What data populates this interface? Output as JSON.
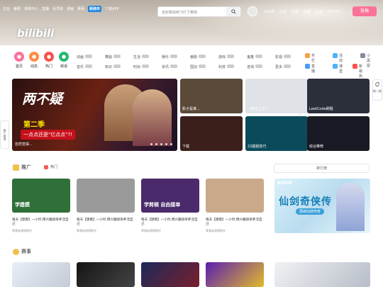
{
  "nav": {
    "left": [
      "主站",
      "番剧",
      "游戏中心",
      "直播",
      "会员购",
      "漫画",
      "赛事"
    ],
    "badge": "新跨年",
    "download": "下载APP"
  },
  "search": {
    "placeholder": "去好像找到飞行了哪场"
  },
  "user": {
    "links": [
      "大会员",
      "消息",
      "动态",
      "收藏",
      "历史",
      "创作中心"
    ],
    "upload": "投稿"
  },
  "logo": "bilibili",
  "channels": [
    {
      "label": "首页",
      "color": "#fb7299"
    },
    {
      "label": "动态",
      "color": "#ff8c43"
    },
    {
      "label": "热门",
      "color": "#f7534b"
    },
    {
      "label": "频道",
      "color": "#27b871"
    }
  ],
  "categories": [
    {
      "name": "动画",
      "num": "",
      "row": 0,
      "col": 0
    },
    {
      "name": "舞蹈",
      "num": "",
      "row": 0,
      "col": 1
    },
    {
      "name": "生活",
      "num": "",
      "row": 0,
      "col": 2
    },
    {
      "name": "娱乐",
      "num": "",
      "row": 0,
      "col": 3
    },
    {
      "name": "番剧",
      "num": "",
      "row": 0,
      "col": 4
    },
    {
      "name": "游戏",
      "num": "",
      "row": 0,
      "col": 5
    },
    {
      "name": "鬼畜",
      "num": "",
      "row": 0,
      "col": 6
    },
    {
      "name": "影视",
      "num": "",
      "row": 0,
      "col": 7
    },
    {
      "name": "音乐",
      "num": "",
      "row": 1,
      "col": 0
    },
    {
      "name": "知识",
      "num": "",
      "row": 1,
      "col": 1
    },
    {
      "name": "时尚",
      "num": "",
      "row": 1,
      "col": 2
    },
    {
      "name": "资讯",
      "num": "",
      "row": 1,
      "col": 3
    },
    {
      "name": "国创",
      "num": "",
      "row": 1,
      "col": 4
    },
    {
      "name": "科技",
      "num": "",
      "row": 1,
      "col": 5
    },
    {
      "name": "咨询",
      "num": "",
      "row": 1,
      "col": 6
    },
    {
      "name": "更多",
      "num": "",
      "row": 1,
      "col": 7
    }
  ],
  "quicklinks": [
    "专栏",
    "活动",
    "小黑屋",
    "直播",
    "课堂",
    "新歌热榜"
  ],
  "carousel": {
    "title": "第二季",
    "caption": "忽然觉得...",
    "slogan": "一点点还是\"亿点点\"?!"
  },
  "videos": [
    {
      "caption": "影子是谁...",
      "color": "#5b4a3a"
    },
    {
      "caption": "《拳王之王》",
      "color": "#dfe2e6"
    },
    {
      "caption": "LeetCode刷题",
      "color": "#2a2f3a"
    },
    {
      "caption": "下载",
      "color": "#3a1f1a"
    },
    {
      "caption": "22腿姐技巧",
      "color": "#0b4a5a"
    },
    {
      "caption": "综合推荐",
      "color": "#1a1a24"
    }
  ],
  "sections": {
    "promo": "推广",
    "hot": "热门",
    "rank": "排行榜",
    "esports": "赛事"
  },
  "cards": [
    {
      "label": "学建模",
      "title": "每天【建模】一小时,用兴趣接单养活自己",
      "author": "零基础建模教学",
      "color": "#2e6f3a"
    },
    {
      "label": "",
      "title": "每天【建模】一小时,用兴趣接单养活自己",
      "author": "零基础建模教学",
      "color": "#9a9a9a"
    },
    {
      "label": "学剪辑 自由接单",
      "title": "每天【建模】一小时,用兴趣接单养活自己",
      "author": "零基础建模教学",
      "color": "#4a2a6a"
    },
    {
      "label": "",
      "title": "每天【建模】一小时,用兴趣接单养活自己",
      "author": "零基础建模教学",
      "color": "#c9a98a"
    }
  ],
  "ad": {
    "title": "仙剑奇侠传",
    "sub": "再续仙侠传奇"
  }
}
